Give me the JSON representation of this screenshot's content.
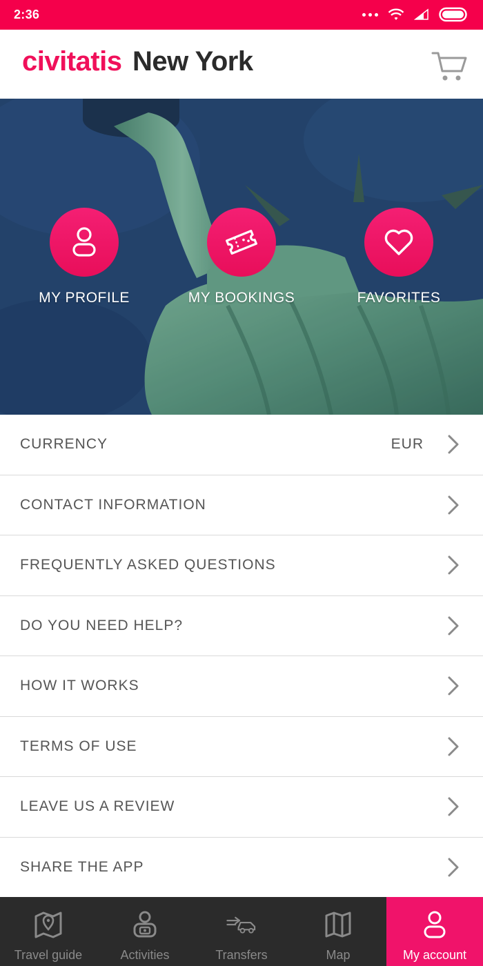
{
  "status_bar": {
    "time": "2:36"
  },
  "header": {
    "brand": "civitatis",
    "city": "New York"
  },
  "hero": {
    "actions": [
      {
        "label": "MY PROFILE",
        "icon": "user-icon"
      },
      {
        "label": "MY BOOKINGS",
        "icon": "ticket-icon"
      },
      {
        "label": "FAVORITES",
        "icon": "heart-icon"
      }
    ]
  },
  "menu": {
    "items": [
      {
        "label": "CURRENCY",
        "value": "EUR"
      },
      {
        "label": "CONTACT INFORMATION"
      },
      {
        "label": "FREQUENTLY ASKED QUESTIONS"
      },
      {
        "label": "DO YOU NEED HELP?"
      },
      {
        "label": "HOW IT WORKS"
      },
      {
        "label": "TERMS OF USE"
      },
      {
        "label": "LEAVE US A REVIEW"
      },
      {
        "label": "SHARE THE APP"
      }
    ]
  },
  "bottom_nav": {
    "items": [
      {
        "label": "Travel guide",
        "icon": "map-pin-icon"
      },
      {
        "label": "Activities",
        "icon": "activities-icon"
      },
      {
        "label": "Transfers",
        "icon": "transfer-car-icon"
      },
      {
        "label": "Map",
        "icon": "folded-map-icon"
      },
      {
        "label": "My account",
        "icon": "user-icon",
        "active": true
      }
    ]
  },
  "colors": {
    "brand": "#f5004b",
    "accent": "#f0136a",
    "nav_bg": "#2b2b2b",
    "text": "#555555"
  }
}
